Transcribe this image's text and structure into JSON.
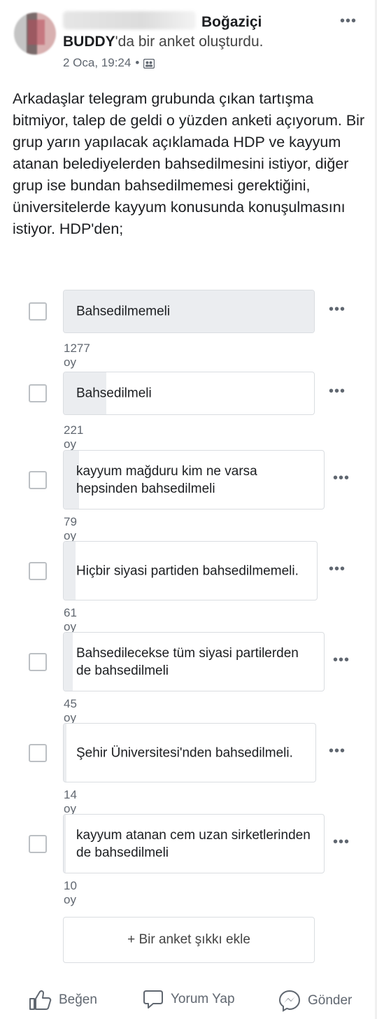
{
  "post": {
    "group_name": "Boğaziçi",
    "author_highlight": "BUDDY",
    "action_text": "'da bir anket oluşturdu.",
    "timestamp": "2 Oca, 19:24",
    "separator": "•",
    "icons": {
      "audience": "group-icon",
      "more": "more-horizontal-icon"
    },
    "more_label": "•••",
    "body": "Arkadaşlar telegram grubunda çıkan tartışma bitmiyor, talep de geldi o yüzden anketi açıyorum. Bir grup yarın yapılacak açıklamada HDP ve kayyum atanan belediyelerden bahsedilmesini istiyor, diğer grup ise bundan bahsedilmemesi gerektiğini, üniversitelerde kayyum konusunda konuşulmasını istiyor. HDP'den;"
  },
  "poll": {
    "options": [
      {
        "label": "Bahsedilmemeli",
        "votes": "1277 oy",
        "share": 1.0
      },
      {
        "label": "Bahsedilmeli",
        "votes": "221 oy",
        "share": 0.17
      },
      {
        "label": "kayyum mağduru kim ne varsa hepsinden bahsedilmeli",
        "votes": "79 oy",
        "share": 0.06
      },
      {
        "label": "Hiçbir siyasi partiden bahsedilmemeli.",
        "votes": "61 oy",
        "share": 0.048
      },
      {
        "label": "Bahsedilecekse tüm siyasi partilerden de bahsedilmeli",
        "votes": "45 oy",
        "share": 0.035
      },
      {
        "label": "Şehir Üniversitesi'nden bahsedilmeli.",
        "votes": "14 oy",
        "share": 0.011
      },
      {
        "label": "kayyum atanan cem uzan sirketlerinden de bahsedilmeli",
        "votes": "10 oy",
        "share": 0.008
      }
    ],
    "add_option": "+ Bir anket şıkkı ekle",
    "colors": {
      "bar_fill": "#ebedf0",
      "border": "#dadde1"
    }
  },
  "footer": {
    "like": "Beğen",
    "comment": "Yorum Yap",
    "send": "Gönder",
    "icons": {
      "like": "thumbs-up-icon",
      "comment": "comment-icon",
      "send": "messenger-icon"
    }
  }
}
